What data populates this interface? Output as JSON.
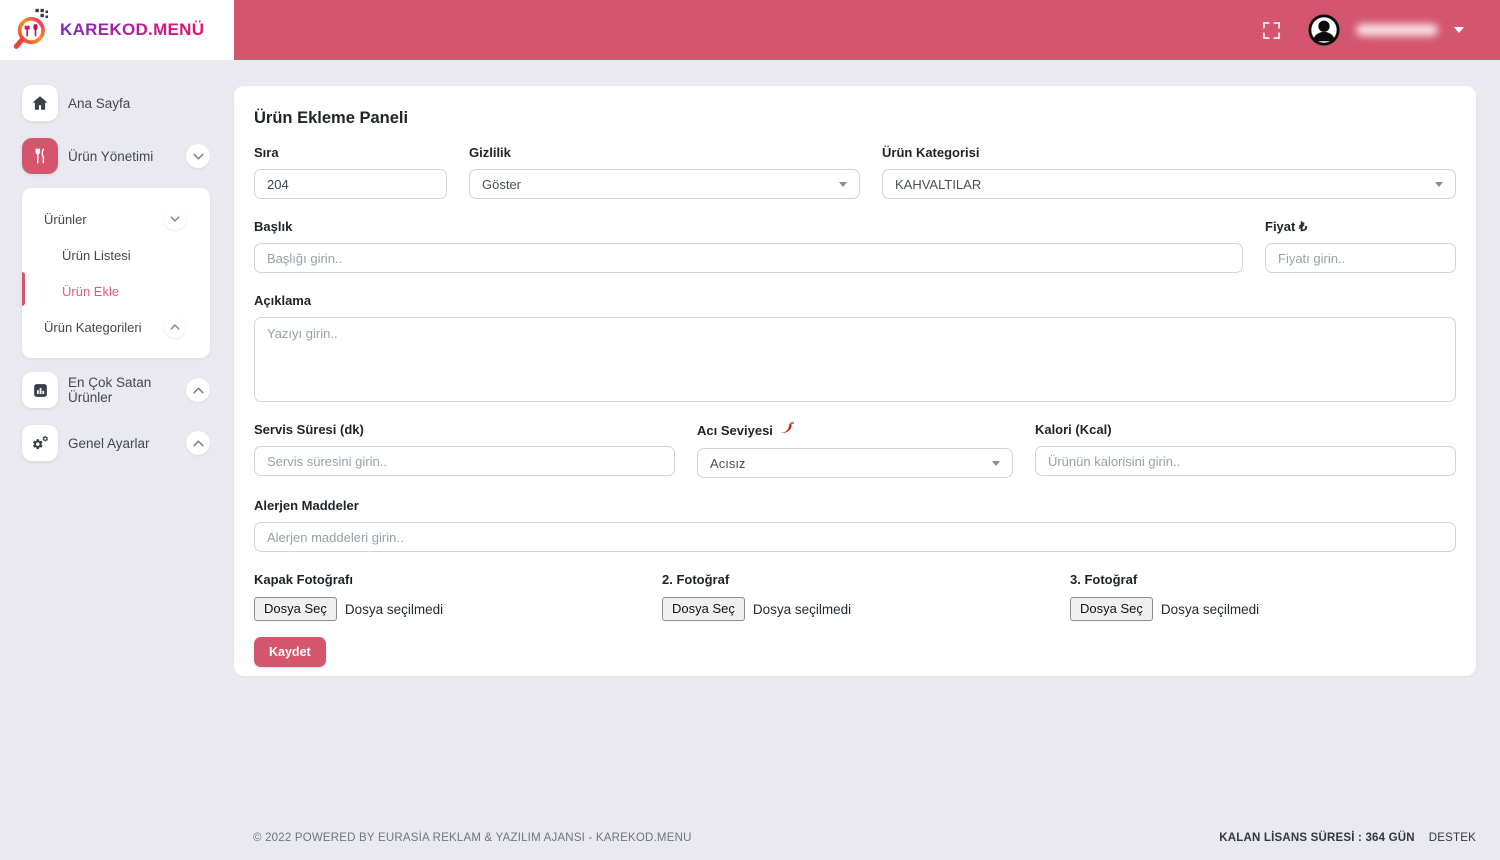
{
  "brand": {
    "logo_text": "KAREKOD.MENÜ"
  },
  "sidebar": {
    "items": [
      {
        "label": "Ana Sayfa"
      },
      {
        "label": "Ürün Yönetimi"
      },
      {
        "label": "En Çok Satan Ürünler"
      },
      {
        "label": "Genel Ayarlar"
      }
    ],
    "submenu": {
      "items": [
        {
          "label": "Ürünler"
        },
        {
          "label": "Ürün Listesi"
        },
        {
          "label": "Ürün Ekle"
        },
        {
          "label": "Ürün Kategorileri"
        }
      ]
    }
  },
  "main": {
    "title": "Ürün Ekleme Paneli",
    "fields": {
      "sira": {
        "label": "Sıra",
        "value": "204"
      },
      "gizlilik": {
        "label": "Gizlilik",
        "value": "Göster"
      },
      "kategori": {
        "label": "Ürün Kategorisi",
        "value": "KAHVALTILAR"
      },
      "baslik": {
        "label": "Başlık",
        "placeholder": "Başlığı girin.."
      },
      "fiyat": {
        "label": "Fiyat ₺",
        "placeholder": "Fiyatı girin.."
      },
      "aciklama": {
        "label": "Açıklama",
        "placeholder": "Yazıyı girin.."
      },
      "servis": {
        "label": "Servis Süresi (dk)",
        "placeholder": "Servis süresini girin.."
      },
      "aci": {
        "label": "Acı Seviyesi",
        "value": "Acısız"
      },
      "kalori": {
        "label": "Kalori (Kcal)",
        "placeholder": "Ürünün kalorisini girin.."
      },
      "alerjen": {
        "label": "Alerjen Maddeler",
        "placeholder": "Alerjen maddeleri girin.."
      },
      "foto1": {
        "label": "Kapak Fotoğrafı",
        "button_label": "Dosya Seç",
        "status": "Dosya seçilmedi"
      },
      "foto2": {
        "label": "2. Fotoğraf",
        "button_label": "Dosya Seç",
        "status": "Dosya seçilmedi"
      },
      "foto3": {
        "label": "3. Fotoğraf",
        "button_label": "Dosya Seç",
        "status": "Dosya seçilmedi"
      }
    },
    "save_label": "Kaydet"
  },
  "footer": {
    "copyright": "© 2022 POWERED BY EURASİA REKLAM & YAZILIM AJANSI - KAREKOD.MENU",
    "license": "KALAN LİSANS SÜRESİ : 364 GÜN",
    "support": "DESTEK"
  },
  "colors": {
    "accent": "#d4556e",
    "active_link": "#de5b7b",
    "background": "#e9e9ef",
    "logo_gradient_start": "#7a2bbd",
    "logo_gradient_end": "#ec0f6b"
  }
}
